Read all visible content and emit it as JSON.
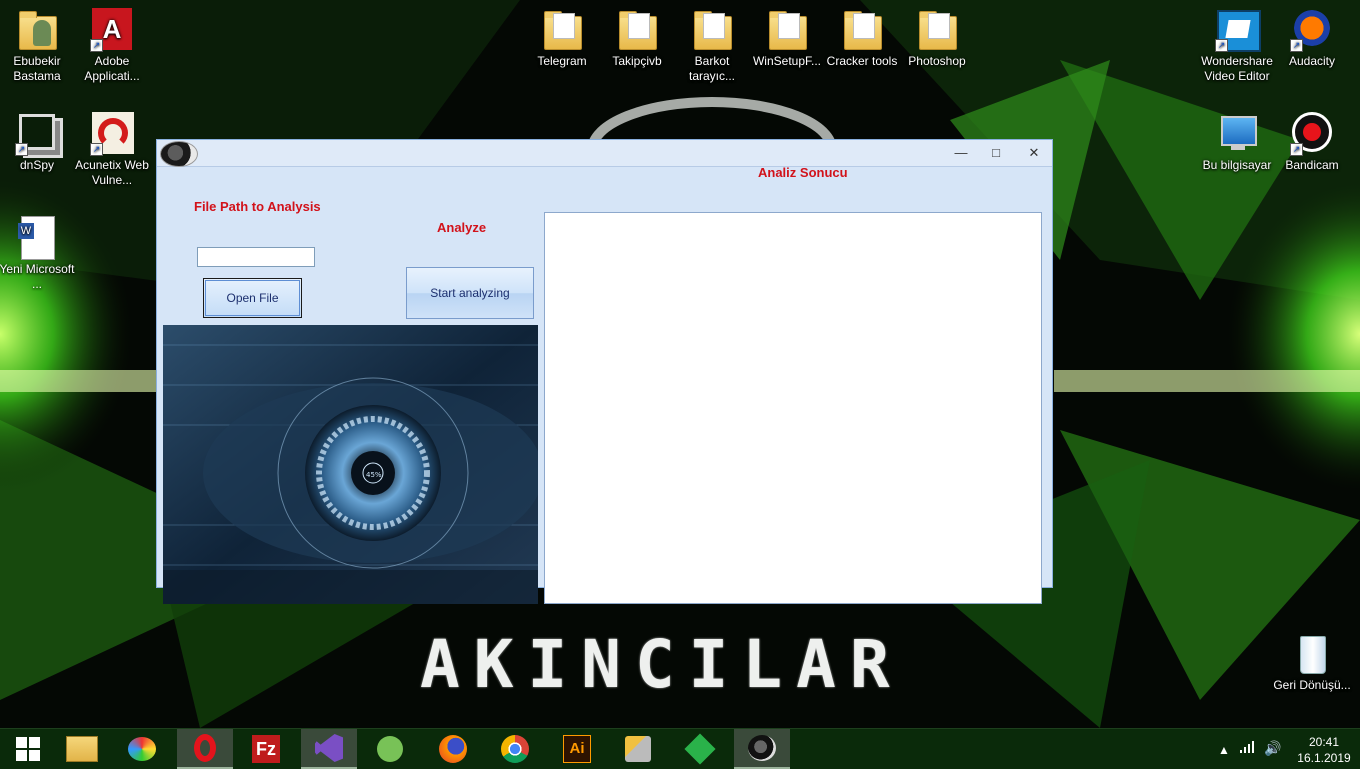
{
  "desktop": {
    "icons": [
      {
        "name": "user-folder-icon",
        "label": "Ebubekir Bastama"
      },
      {
        "name": "adobe-acrobat-icon",
        "label": "Adobe Applicati..."
      },
      {
        "name": "dnspy-icon",
        "label": "dnSpy"
      },
      {
        "name": "acunetix-icon",
        "label": "Acunetix Web Vulne..."
      },
      {
        "name": "word-document-icon",
        "label": "Yeni Microsoft ..."
      },
      {
        "name": "telegram-folder-icon",
        "label": "Telegram"
      },
      {
        "name": "takipcivb-folder-icon",
        "label": "Takipçivb"
      },
      {
        "name": "barkot-folder-icon",
        "label": "Barkot tarayıc..."
      },
      {
        "name": "winsetup-folder-icon",
        "label": "WinSetupF..."
      },
      {
        "name": "cracker-tools-folder-icon",
        "label": "Cracker tools"
      },
      {
        "name": "photoshop-folder-icon",
        "label": "Photoshop"
      },
      {
        "name": "wondershare-icon",
        "label": "Wondershare Video Editor"
      },
      {
        "name": "audacity-icon",
        "label": "Audacity"
      },
      {
        "name": "this-pc-icon",
        "label": "Bu bilgisayar"
      },
      {
        "name": "bandicam-icon",
        "label": "Bandicam"
      },
      {
        "name": "recycle-bin-icon",
        "label": "Geri Dönüşü..."
      }
    ],
    "wallpaper_text": "AKINCILAR"
  },
  "window": {
    "minimize": "—",
    "maximize": "□",
    "close": "✕",
    "file_path_label": "File Path to Analysis",
    "file_path_value": "",
    "open_file_button": "Open File",
    "analyze_label": "Analyze",
    "start_analyzing_button": "Start analyzing",
    "result_label": "Analiz Sonucu",
    "result_text": "",
    "eye_image_text": "45%"
  },
  "taskbar": {
    "apps": [
      "start",
      "file-explorer",
      "paint",
      "opera",
      "filezilla",
      "visual-studio",
      "android-studio",
      "firefox",
      "chrome",
      "illustrator",
      "tools",
      "git-fork",
      "akincilar-app"
    ],
    "clock_time": "20:41",
    "clock_date": "16.1.2019"
  },
  "colors": {
    "accent_red": "#d2121a",
    "window_bg": "#d6e5f7",
    "wallpaper_green": "#3cd22a"
  }
}
